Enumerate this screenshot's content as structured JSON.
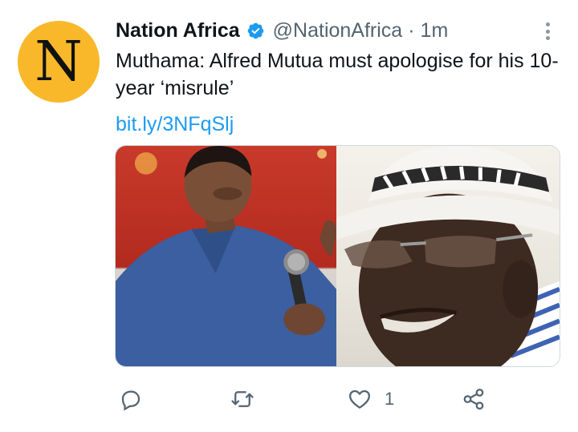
{
  "tweet": {
    "avatar_letter": "N",
    "author_name": "Nation Africa",
    "handle": "@NationAfrica",
    "separator": "·",
    "time": "1m",
    "text": "Muthama: Alfred Mutua must apologise for his 10-year ‘misrule’",
    "link": "bit.ly/3NFqSlj",
    "media": [
      {
        "name": "photo-man-with-microphone"
      },
      {
        "name": "photo-man-in-white-hat"
      }
    ],
    "actions": {
      "reply_icon": "reply-icon",
      "retweet_icon": "retweet-icon",
      "like_icon": "heart-icon",
      "like_count": "1",
      "share_icon": "share-icon"
    }
  },
  "colors": {
    "avatar_bg": "#f8b82a",
    "verified": "#1d9bf0",
    "link": "#1d9bf0",
    "secondary_text": "#536471",
    "icon": "#536471"
  }
}
